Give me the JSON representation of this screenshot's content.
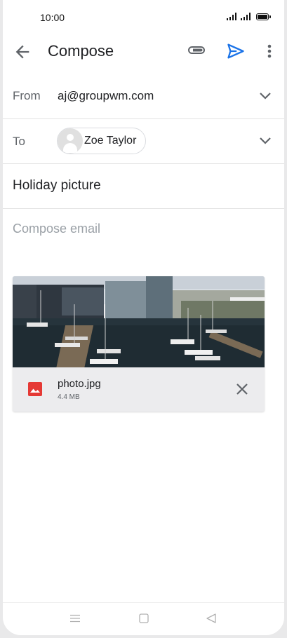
{
  "status_bar": {
    "time": "10:00"
  },
  "app_bar": {
    "title": "Compose",
    "icons": [
      "arrow-back-icon",
      "paperclip-icon",
      "send-icon",
      "more-vert-icon"
    ],
    "accent_color": "#1a73e8"
  },
  "from": {
    "label": "From",
    "value": "aj@groupwm.com"
  },
  "to": {
    "label": "To",
    "recipients": [
      {
        "name": "Zoe Taylor"
      }
    ]
  },
  "subject": {
    "value": "Holiday picture"
  },
  "body": {
    "placeholder": "Compose email"
  },
  "attachment": {
    "file_name": "photo.jpg",
    "file_size": "4.4 MB",
    "icon": "image-file-icon",
    "icon_color": "#e53935"
  },
  "system_nav": {
    "icons": [
      "menu-icon",
      "home-icon",
      "back-triangle-icon"
    ]
  }
}
